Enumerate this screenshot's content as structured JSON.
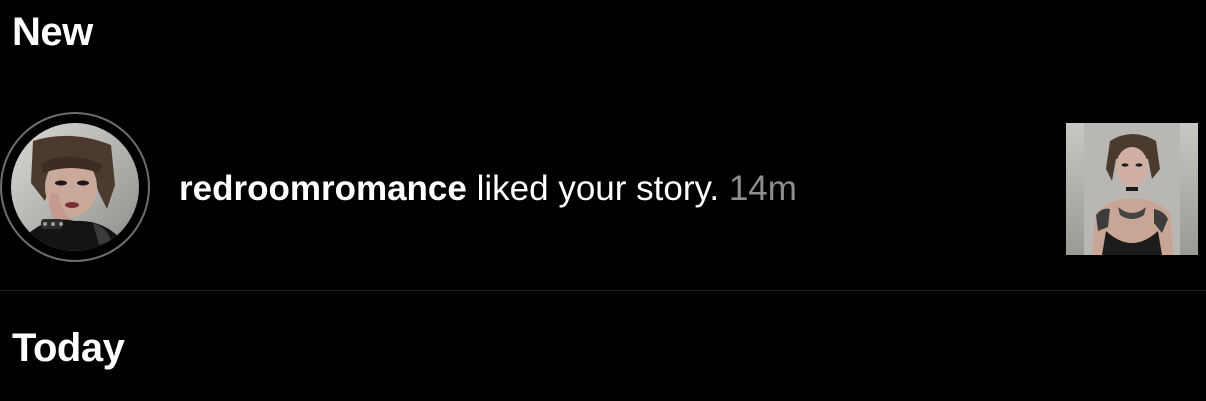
{
  "sections": {
    "new": "New",
    "today": "Today"
  },
  "notification": {
    "username": "redroomromance",
    "action": "liked your story.",
    "time": "14m",
    "avatar": "profile-photo",
    "thumbnail": "story-photo"
  },
  "colors": {
    "background": "#000000",
    "text": "#ffffff",
    "time": "#8e8e8e",
    "avatar_ring": "#6e6e6e",
    "divider": "#1f1f1f"
  }
}
